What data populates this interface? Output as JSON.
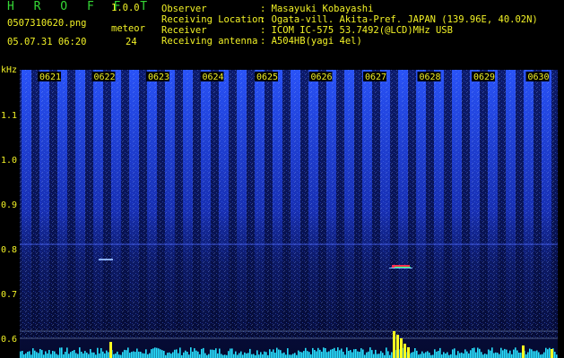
{
  "header": {
    "app_title": "H R O F F T",
    "app_version": "1.0.0",
    "file_name": "0507310620.png",
    "count_label": "meteor",
    "date_time": "05.07.31 06:20",
    "count_value": "24"
  },
  "info": [
    {
      "label": "Observer",
      "value": ": Masayuki Kobayashi"
    },
    {
      "label": "Receiving Location",
      "value": ": Ogata-vill. Akita-Pref. JAPAN (139.96E, 40.02N)"
    },
    {
      "label": "Receiver",
      "value": ": ICOM IC-575 53.7492(@LCD)MHz USB"
    },
    {
      "label": "Receiving antenna",
      "value": ": A504HB(yagi 4el)"
    }
  ],
  "axis": {
    "unit": "kHz",
    "y_ticks": [
      "1.1",
      "1.0",
      "0.9",
      "0.8",
      "0.7",
      "0.6"
    ],
    "minute_labels": [
      "0621",
      "0622",
      "0623",
      "0624",
      "0625",
      "0626",
      "0627",
      "0628",
      "0629",
      "0630"
    ]
  },
  "colors": {
    "header_yellow": "#f2f226",
    "header_green": "#35d835",
    "background": "#000000",
    "signal_blue": "#1a3ad8",
    "activity_cyan": "#28e0ff",
    "meteor_yellow": "#ffff20"
  }
}
